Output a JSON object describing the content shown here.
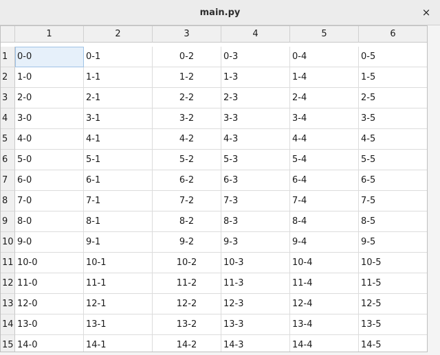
{
  "window": {
    "title": "main.py",
    "close_glyph": "×"
  },
  "table": {
    "columns": [
      "1",
      "2",
      "3",
      "4",
      "5",
      "6"
    ],
    "rows": [
      {
        "header": "1",
        "cells": [
          "0-0",
          "0-1",
          "0-2",
          "0-3",
          "0-4",
          "0-5"
        ]
      },
      {
        "header": "2",
        "cells": [
          "1-0",
          "1-1",
          "1-2",
          "1-3",
          "1-4",
          "1-5"
        ]
      },
      {
        "header": "3",
        "cells": [
          "2-0",
          "2-1",
          "2-2",
          "2-3",
          "2-4",
          "2-5"
        ]
      },
      {
        "header": "4",
        "cells": [
          "3-0",
          "3-1",
          "3-2",
          "3-3",
          "3-4",
          "3-5"
        ]
      },
      {
        "header": "5",
        "cells": [
          "4-0",
          "4-1",
          "4-2",
          "4-3",
          "4-4",
          "4-5"
        ]
      },
      {
        "header": "6",
        "cells": [
          "5-0",
          "5-1",
          "5-2",
          "5-3",
          "5-4",
          "5-5"
        ]
      },
      {
        "header": "7",
        "cells": [
          "6-0",
          "6-1",
          "6-2",
          "6-3",
          "6-4",
          "6-5"
        ]
      },
      {
        "header": "8",
        "cells": [
          "7-0",
          "7-1",
          "7-2",
          "7-3",
          "7-4",
          "7-5"
        ]
      },
      {
        "header": "9",
        "cells": [
          "8-0",
          "8-1",
          "8-2",
          "8-3",
          "8-4",
          "8-5"
        ]
      },
      {
        "header": "10",
        "cells": [
          "9-0",
          "9-1",
          "9-2",
          "9-3",
          "9-4",
          "9-5"
        ]
      },
      {
        "header": "11",
        "cells": [
          "10-0",
          "10-1",
          "10-2",
          "10-3",
          "10-4",
          "10-5"
        ]
      },
      {
        "header": "12",
        "cells": [
          "11-0",
          "11-1",
          "11-2",
          "11-3",
          "11-4",
          "11-5"
        ]
      },
      {
        "header": "13",
        "cells": [
          "12-0",
          "12-1",
          "12-2",
          "12-3",
          "12-4",
          "12-5"
        ]
      },
      {
        "header": "14",
        "cells": [
          "13-0",
          "13-1",
          "13-2",
          "13-3",
          "13-4",
          "13-5"
        ]
      },
      {
        "header": "15",
        "cells": [
          "14-0",
          "14-1",
          "14-2",
          "14-3",
          "14-4",
          "14-5"
        ]
      }
    ]
  }
}
